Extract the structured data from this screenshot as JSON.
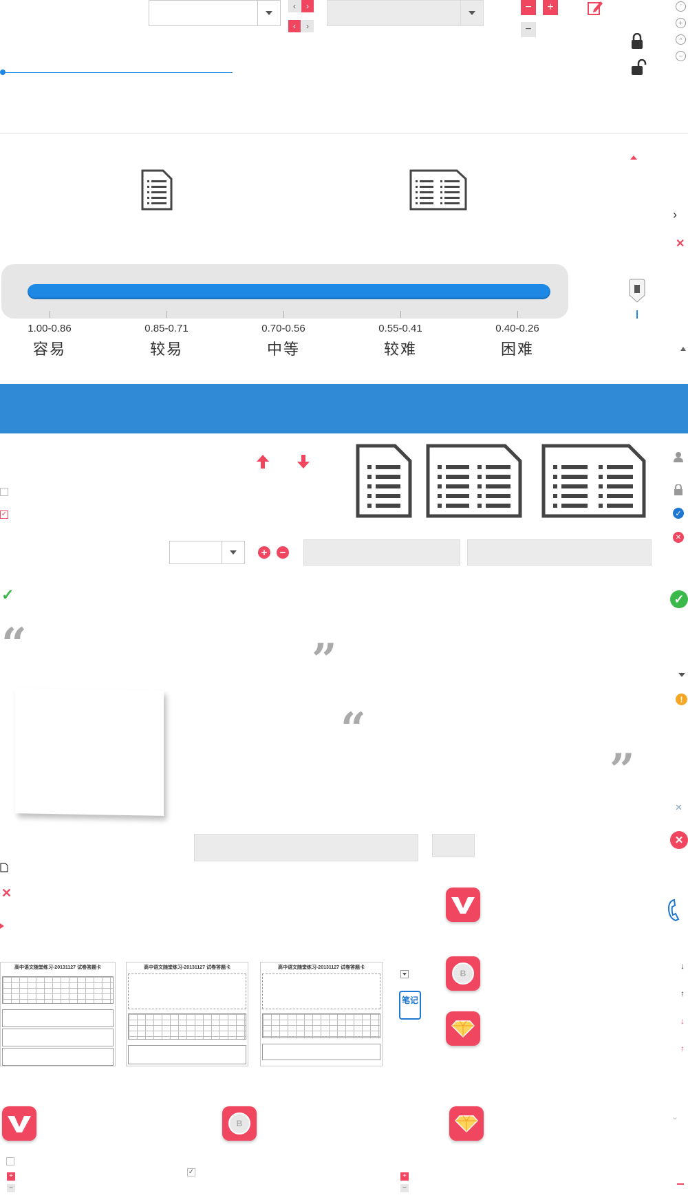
{
  "colors": {
    "accent": "#f0465f",
    "blue": "#1e88e5",
    "banner": "#318ad6",
    "green": "#3cb94b",
    "orange": "#f5a623",
    "grey": "#555555"
  },
  "difficulty_slider": {
    "fill_fraction": 1.0,
    "levels": [
      {
        "range": "1.00-0.86",
        "name": "容易"
      },
      {
        "range": "0.85-0.71",
        "name": "较易"
      },
      {
        "range": "0.70-0.56",
        "name": "中等"
      },
      {
        "range": "0.55-0.41",
        "name": "较难"
      },
      {
        "range": "0.40-0.26",
        "name": "困难"
      }
    ]
  },
  "answer_sheets": [
    {
      "title": "高中语文随堂练习-20131127 试卷答题卡"
    },
    {
      "title": "高中语文随堂练习-20131127 试卷答题卡"
    },
    {
      "title": "高中语文随堂练习-20131127 试卷答题卡"
    }
  ],
  "note_icon": {
    "text": "笔记"
  },
  "icons": [
    "chevron-left-icon",
    "chevron-right-icon",
    "minus-icon",
    "plus-icon",
    "edit-icon",
    "lock-icon",
    "unlock-icon",
    "document-icon",
    "two-column-document-icon",
    "three-column-document-icon",
    "arrow-up-icon",
    "arrow-down-icon",
    "user-icon",
    "check-circle-icon",
    "close-circle-icon",
    "warning-icon",
    "quote-open-icon",
    "quote-close-icon",
    "phone-icon",
    "v-app-icon",
    "b-coin-app-icon",
    "diamond-app-icon"
  ]
}
